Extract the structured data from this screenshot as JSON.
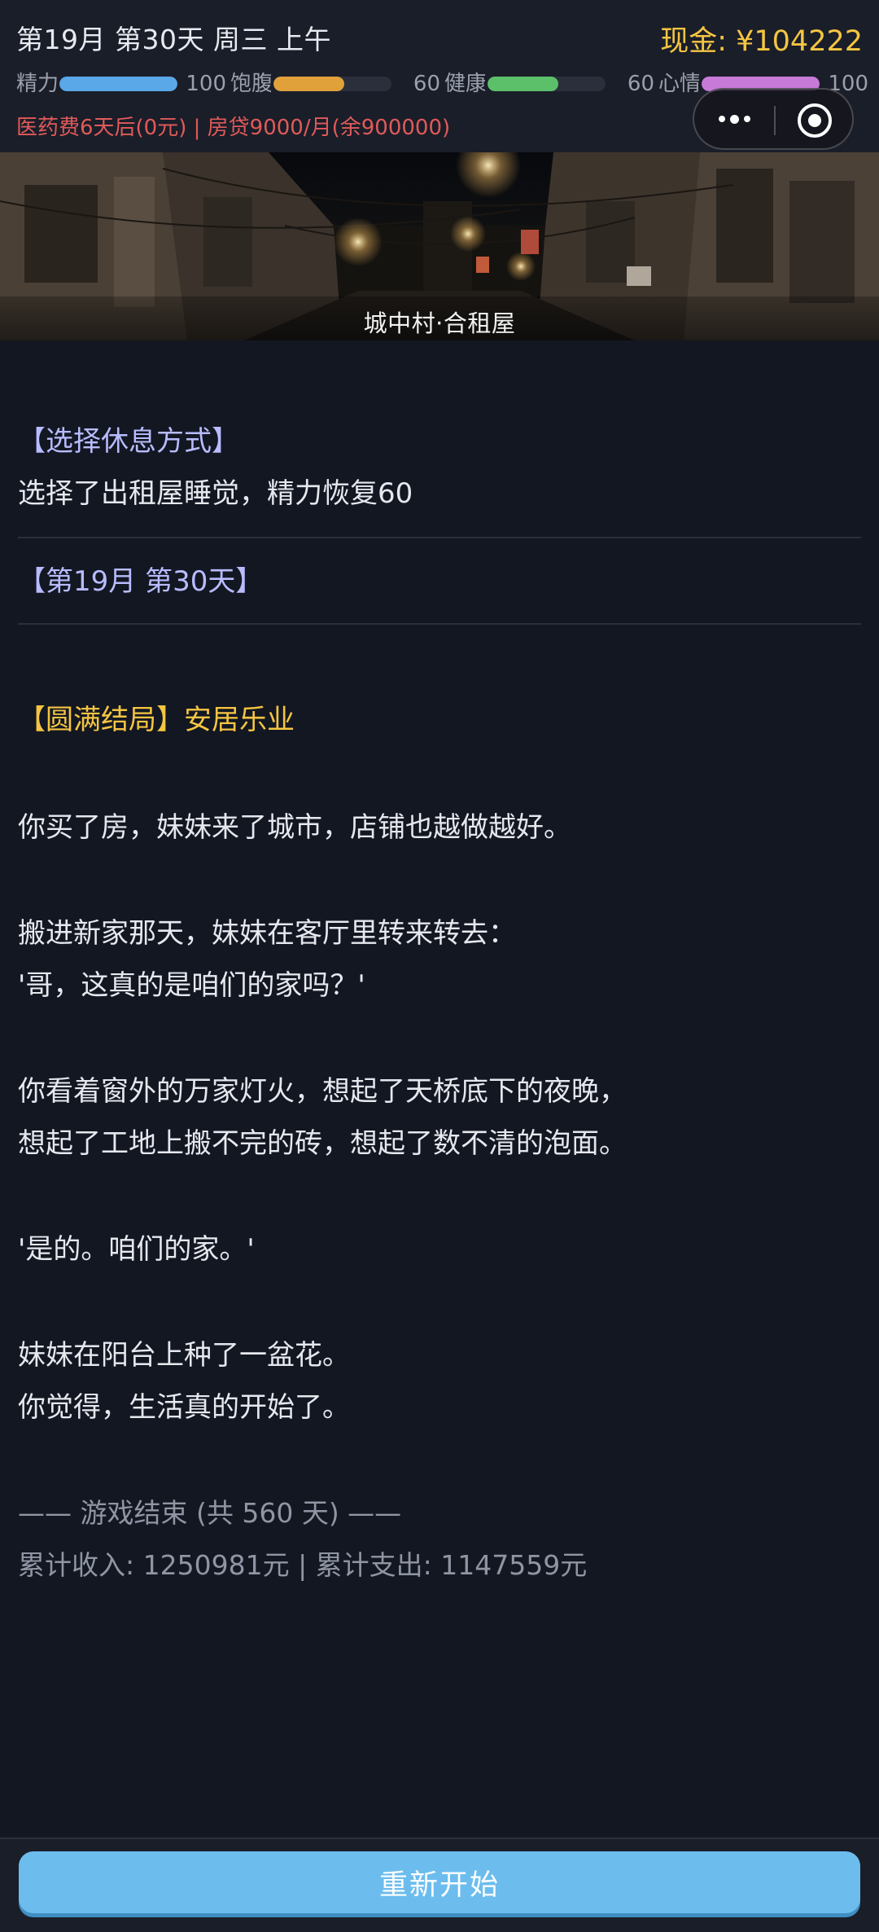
{
  "header": {
    "date": "第19月 第30天 周三 上午",
    "cash": "现金: ¥104222",
    "bills": "医药费6天后(0元) | 房贷9000/月(余900000)"
  },
  "stats": [
    {
      "label": "精力",
      "value": 100,
      "max": 100,
      "color": "#5aa8e8"
    },
    {
      "label": "饱腹",
      "value": 60,
      "max": 100,
      "color": "#e0a03a"
    },
    {
      "label": "健康",
      "value": 60,
      "max": 100,
      "color": "#5cc06a"
    },
    {
      "label": "心情",
      "value": 100,
      "max": 100,
      "color": "#c77ad8"
    }
  ],
  "scene": {
    "caption": "城中村·合租屋"
  },
  "log": {
    "rest_title": "【选择休息方式】",
    "rest_text": "选择了出租屋睡觉，精力恢复60",
    "day_header": "【第19月 第30天】",
    "ending_title": "【圆满结局】安居乐业",
    "p1": "你买了房，妹妹来了城市，店铺也越做越好。",
    "p2a": "搬进新家那天，妹妹在客厅里转来转去：",
    "p2b": "'哥，这真的是咱们的家吗？'",
    "p3a": "你看着窗外的万家灯火，想起了天桥底下的夜晚，",
    "p3b": "想起了工地上搬不完的砖，想起了数不清的泡面。",
    "p4": "'是的。咱们的家。'",
    "p5a": "妹妹在阳台上种了一盆花。",
    "p5b": "你觉得，生活真的开始了。",
    "game_over": "—— 游戏结束 (共 560 天) ——",
    "totals": "累计收入: 1250981元 | 累计支出: 1147559元"
  },
  "actions": {
    "restart_label": "重新开始"
  }
}
